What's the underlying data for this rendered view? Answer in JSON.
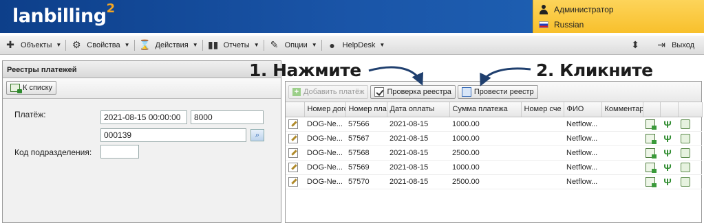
{
  "app": {
    "logo_text": "lanbilling",
    "logo_sup": "2",
    "user_label": "Администратор",
    "language_label": "Russian",
    "accent_color": "#f8c02c",
    "header_color": "#1a55a8"
  },
  "menu": {
    "items": [
      {
        "label": "Объекты",
        "icon": "puzzle-icon"
      },
      {
        "label": "Свойства",
        "icon": "gear-icon"
      },
      {
        "label": "Действия",
        "icon": "hourglass-icon"
      },
      {
        "label": "Отчеты",
        "icon": "bar-chart-icon"
      },
      {
        "label": "Опции",
        "icon": "wrench-icon"
      },
      {
        "label": "HelpDesk",
        "icon": "chat-bubble-icon"
      }
    ],
    "exit_label": "Выход"
  },
  "left": {
    "title": "Реестры платежей",
    "back_button": "К списку",
    "payment_label": "Платёж:",
    "date_value": "2021-08-15 00:00:00",
    "amount_value": "8000",
    "code_value": "000139",
    "division_label": "Код подразделения:",
    "division_value": ""
  },
  "right": {
    "add_button": "Добавить платёж",
    "check_button": "Проверка реестра",
    "apply_button": "Провести реестр",
    "columns": [
      "Номер дого",
      "Номер пла",
      "Дата оплаты",
      "Сумма платежа",
      "Номер сче",
      "ФИО",
      "Комментар"
    ],
    "rows": [
      {
        "contract": "DOG-Ne...",
        "number": "57566",
        "date": "2021-08-15",
        "sum": "1000.00",
        "account": "",
        "fio": "Netflow...",
        "comment": ""
      },
      {
        "contract": "DOG-Ne...",
        "number": "57567",
        "date": "2021-08-15",
        "sum": "1000.00",
        "account": "",
        "fio": "Netflow...",
        "comment": ""
      },
      {
        "contract": "DOG-Ne...",
        "number": "57568",
        "date": "2021-08-15",
        "sum": "2500.00",
        "account": "",
        "fio": "Netflow...",
        "comment": ""
      },
      {
        "contract": "DOG-Ne...",
        "number": "57569",
        "date": "2021-08-15",
        "sum": "1000.00",
        "account": "",
        "fio": "Netflow...",
        "comment": ""
      },
      {
        "contract": "DOG-Ne...",
        "number": "57570",
        "date": "2021-08-15",
        "sum": "2500.00",
        "account": "",
        "fio": "Netflow...",
        "comment": ""
      }
    ]
  },
  "annotations": {
    "step1": "1. Нажмите",
    "step2": "2. Кликните"
  }
}
